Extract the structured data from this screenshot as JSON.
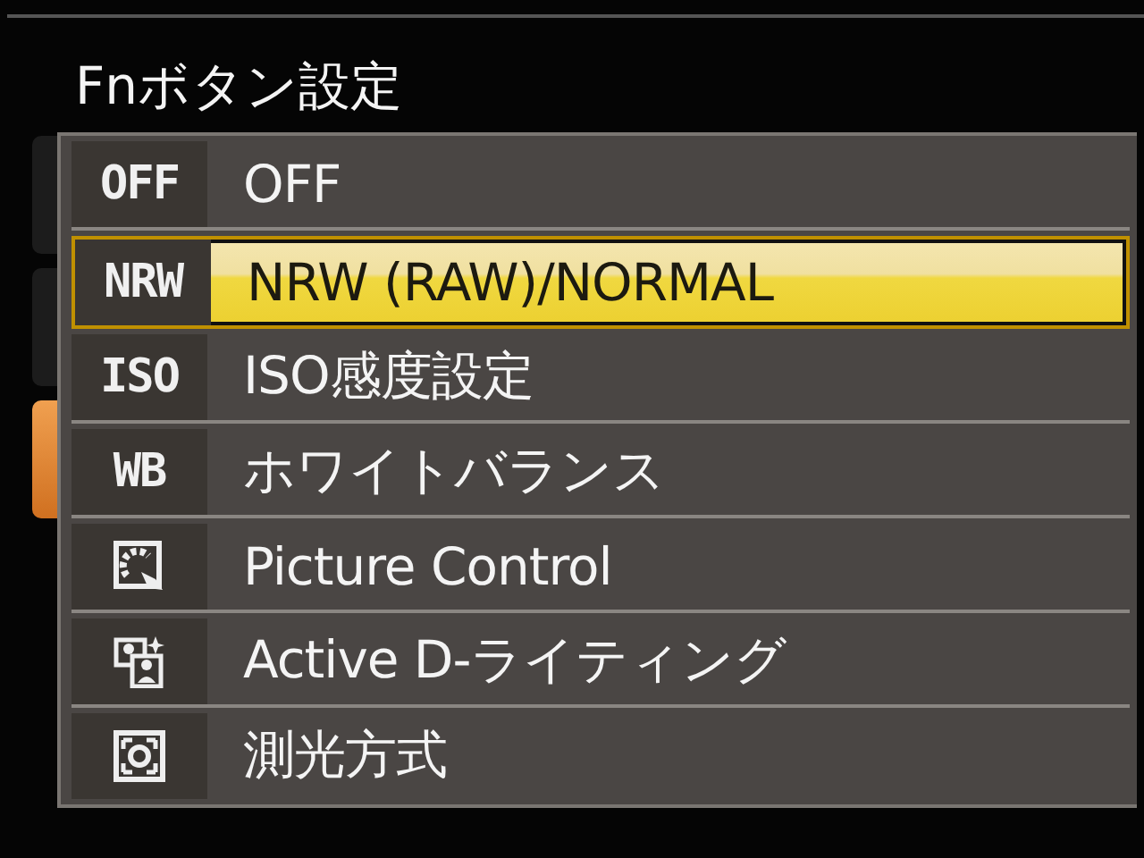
{
  "title": "Fnボタン設定",
  "side_tabs": [
    {
      "selected": false
    },
    {
      "selected": false
    },
    {
      "selected": true
    }
  ],
  "items": [
    {
      "kind": "text",
      "icon": "OFF",
      "label": "OFF",
      "selected": false
    },
    {
      "kind": "text",
      "icon": "NRW",
      "label": "NRW (RAW)/NORMAL",
      "selected": true
    },
    {
      "kind": "text",
      "icon": "ISO",
      "label": "ISO感度設定",
      "selected": false
    },
    {
      "kind": "text",
      "icon": "WB",
      "label": "ホワイトバランス",
      "selected": false
    },
    {
      "kind": "picture",
      "label": "Picture Control",
      "selected": false
    },
    {
      "kind": "lighting",
      "label": "Active D-ライティング",
      "selected": false
    },
    {
      "kind": "metering",
      "label": "測光方式",
      "selected": false
    }
  ]
}
